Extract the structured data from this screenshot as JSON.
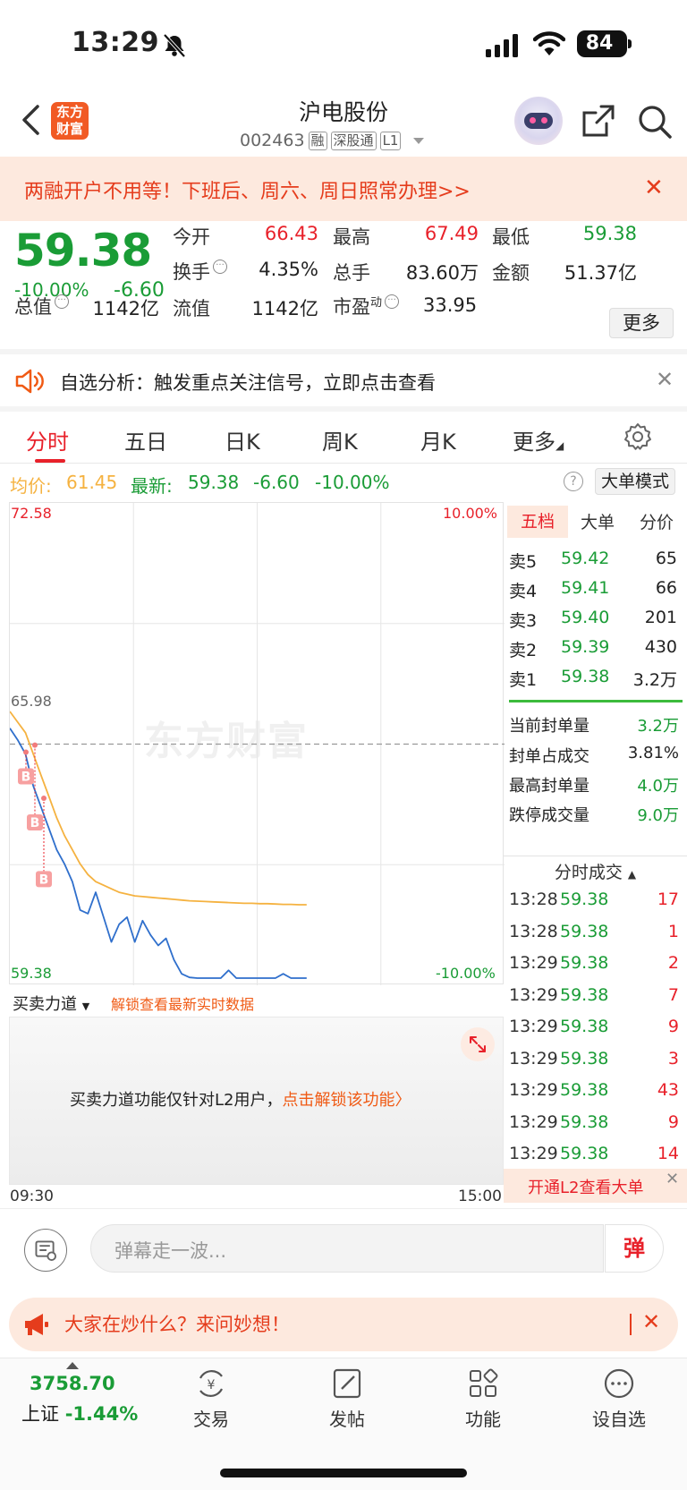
{
  "status": {
    "time": "13:29",
    "battery": "84"
  },
  "header": {
    "logo_line1": "东方",
    "logo_line2": "财富",
    "stock_name": "沪电股份",
    "stock_code": "002463",
    "tags": [
      "融",
      "深股通",
      "L1"
    ]
  },
  "banner": {
    "text": "两融开户不用等！下班后、周六、周日照常办理>>"
  },
  "quote": {
    "price": "59.38",
    "change_pct": "-10.00%",
    "change": "-6.60",
    "fields": {
      "open_label": "今开",
      "open": "66.43",
      "high_label": "最高",
      "high": "67.49",
      "low_label": "最低",
      "low": "59.38",
      "turnover_label": "换手",
      "turnover": "4.35%",
      "volume_label": "总手",
      "volume": "83.60万",
      "amount_label": "金额",
      "amount": "51.37亿",
      "mktcap_label": "总值",
      "mktcap": "1142亿",
      "float_label": "流值",
      "float": "1142亿",
      "pe_label": "市盈",
      "pe_sup": "动",
      "pe": "33.95"
    },
    "more_label": "更多"
  },
  "notice": {
    "text": "自选分析：触发重点关注信号，立即点击查看"
  },
  "tabs": [
    "分时",
    "五日",
    "日K",
    "周K",
    "月K",
    "更多"
  ],
  "summary": {
    "avg_label": "均价:",
    "avg": "61.45",
    "latest_label": "最新:",
    "latest": "59.38",
    "latest_chg": "-6.60",
    "latest_pct": "-10.00%",
    "help": "?",
    "bigmode": "大单模式"
  },
  "chart_labels": {
    "top_price": "72.58",
    "top_pct": "10.00%",
    "mid_price": "65.98",
    "bottom_price": "59.38",
    "bottom_pct": "-10.00%",
    "watermark": "东方财富",
    "marker": "B",
    "time_start": "09:30",
    "time_end": "15:00"
  },
  "chart_data": {
    "type": "line",
    "ylim": [
      59.38,
      72.58
    ],
    "prev_close": 65.98,
    "series": [
      {
        "values": [
          66.43,
          66.1,
          65.7,
          64.8,
          64.2,
          63.6,
          63.0,
          62.6,
          62.1,
          61.3,
          61.2,
          61.8,
          61.1,
          60.4,
          60.9,
          61.1,
          60.4,
          61.0,
          60.6,
          60.3,
          60.5,
          59.9,
          59.5,
          59.4,
          59.38,
          59.38,
          59.38,
          59.38,
          59.6,
          59.38,
          59.38,
          59.38,
          59.38,
          59.38,
          59.38,
          59.5,
          59.38,
          59.38,
          59.38
        ]
      },
      {
        "values": [
          66.9,
          66.6,
          66.3,
          65.7,
          65.1,
          64.5,
          63.9,
          63.4,
          63.0,
          62.6,
          62.3,
          62.1,
          62.0,
          61.9,
          61.8,
          61.75,
          61.7,
          61.68,
          61.66,
          61.64,
          61.62,
          61.6,
          61.58,
          61.56,
          61.55,
          61.54,
          61.53,
          61.52,
          61.51,
          61.5,
          61.49,
          61.49,
          61.48,
          61.48,
          61.47,
          61.46,
          61.46,
          61.45,
          61.45
        ]
      }
    ],
    "colors": {
      "price": "#2f6fcc",
      "avg": "#f5b240",
      "prev_close": "#999999"
    }
  },
  "force": {
    "title": "买卖力道",
    "unlock": "解锁查看最新实时数据",
    "msg": "买卖力道功能仅针对L2用户，",
    "link": "点击解锁该功能"
  },
  "rpanel": {
    "tabs": [
      "五档",
      "大单",
      "分价"
    ],
    "orderbook": [
      {
        "label": "卖5",
        "price": "59.42",
        "vol": "65"
      },
      {
        "label": "卖4",
        "price": "59.41",
        "vol": "66"
      },
      {
        "label": "卖3",
        "price": "59.40",
        "vol": "201"
      },
      {
        "label": "卖2",
        "price": "59.39",
        "vol": "430"
      },
      {
        "label": "卖1",
        "price": "59.38",
        "vol": "3.2万"
      }
    ],
    "seal": [
      {
        "label": "当前封单量",
        "value": "3.2万"
      },
      {
        "label": "封单占成交",
        "value": "3.81%"
      },
      {
        "label": "最高封单量",
        "value": "4.0万"
      },
      {
        "label": "跌停成交量",
        "value": "9.0万"
      }
    ],
    "trades_title": "分时成交",
    "trades": [
      {
        "time": "13:28",
        "price": "59.38",
        "vol": "17"
      },
      {
        "time": "13:28",
        "price": "59.38",
        "vol": "1"
      },
      {
        "time": "13:29",
        "price": "59.38",
        "vol": "2"
      },
      {
        "time": "13:29",
        "price": "59.38",
        "vol": "7"
      },
      {
        "time": "13:29",
        "price": "59.38",
        "vol": "9"
      },
      {
        "time": "13:29",
        "price": "59.38",
        "vol": "3"
      },
      {
        "time": "13:29",
        "price": "59.38",
        "vol": "43"
      },
      {
        "time": "13:29",
        "price": "59.38",
        "vol": "9"
      },
      {
        "time": "13:29",
        "price": "59.38",
        "vol": "14"
      }
    ],
    "l2_text": "开通L2查看大单"
  },
  "danmu": {
    "placeholder": "弹幕走一波...",
    "button": "弹"
  },
  "hot": {
    "text": "大家在炒什么？来问妙想！"
  },
  "bottom_nav": {
    "index_value": "3758.70",
    "index_name": "上证",
    "index_pct": "-1.44%",
    "items": [
      "交易",
      "发帖",
      "功能",
      "设自选"
    ]
  }
}
